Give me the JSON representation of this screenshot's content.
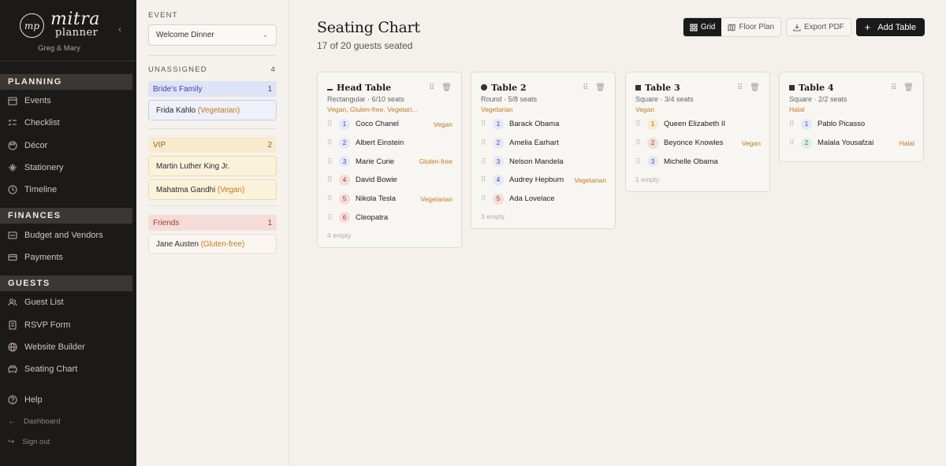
{
  "brand": {
    "logo_mark": "mp",
    "name_line1": "mitra",
    "name_line2": "planner",
    "couple": "Greg & Mary"
  },
  "nav": {
    "planning_header": "PLANNING",
    "planning": [
      "Events",
      "Checklist",
      "Décor",
      "Stationery",
      "Timeline"
    ],
    "finances_header": "FINANCES",
    "finances": [
      "Budget and Vendors",
      "Payments"
    ],
    "guests_header": "GUESTS",
    "guests": [
      "Guest List",
      "RSVP Form",
      "Website Builder",
      "Seating Chart"
    ],
    "help": "Help",
    "dashboard": "Dashboard",
    "signout": "Sign out"
  },
  "panel": {
    "event_label": "EVENT",
    "event_value": "Welcome Dinner",
    "unassigned_label": "UNASSIGNED",
    "unassigned_count": "4",
    "groups": [
      {
        "name": "Bride's Family",
        "count": "1",
        "guests": [
          {
            "name": "Frida Kahlo",
            "diet": "(Vegetarian)"
          }
        ]
      },
      {
        "name": "VIP",
        "count": "2",
        "guests": [
          {
            "name": "Martin Luther King Jr.",
            "diet": ""
          },
          {
            "name": "Mahatma Gandhi",
            "diet": "(Vegan)"
          }
        ]
      },
      {
        "name": "Friends",
        "count": "1",
        "guests": [
          {
            "name": "Jane Austen",
            "diet": "(Gluten-free)"
          }
        ]
      }
    ]
  },
  "main": {
    "title": "Seating Chart",
    "subtitle": "17 of 20 guests seated",
    "view_grid": "Grid",
    "view_floor": "Floor Plan",
    "export": "Export PDF",
    "add_table": "Add Table"
  },
  "tables": [
    {
      "name": "Head Table",
      "meta": "Rectangular · 6/10 seats",
      "diets": "Vegan, Gluten-free, Vegetari...",
      "empty": "4 empty",
      "seats": [
        {
          "n": "1",
          "name": "Coco Chanel",
          "diet": "Vegan"
        },
        {
          "n": "2",
          "name": "Albert Einstein",
          "diet": ""
        },
        {
          "n": "3",
          "name": "Marie Curie",
          "diet": "Gluten-free"
        },
        {
          "n": "4",
          "name": "David Bowie",
          "diet": ""
        },
        {
          "n": "5",
          "name": "Nikola Tesla",
          "diet": "Vegetarian"
        },
        {
          "n": "6",
          "name": "Cleopatra",
          "diet": ""
        }
      ]
    },
    {
      "name": "Table 2",
      "meta": "Round · 5/8 seats",
      "diets": "Vegetarian",
      "empty": "3 empty",
      "seats": [
        {
          "n": "1",
          "name": "Barack Obama",
          "diet": ""
        },
        {
          "n": "2",
          "name": "Amelia Earhart",
          "diet": ""
        },
        {
          "n": "3",
          "name": "Nelson Mandela",
          "diet": ""
        },
        {
          "n": "4",
          "name": "Audrey Hepburn",
          "diet": "Vegetarian"
        },
        {
          "n": "5",
          "name": "Ada Lovelace",
          "diet": ""
        }
      ]
    },
    {
      "name": "Table 3",
      "meta": "Square · 3/4 seats",
      "diets": "Vegan",
      "empty": "1 empty",
      "seats": [
        {
          "n": "1",
          "name": "Queen Elizabeth II",
          "diet": ""
        },
        {
          "n": "2",
          "name": "Beyonce Knowles",
          "diet": "Vegan"
        },
        {
          "n": "3",
          "name": "Michelle Obama",
          "diet": ""
        }
      ]
    },
    {
      "name": "Table 4",
      "meta": "Square · 2/2 seats",
      "diets": "Halal",
      "empty": "",
      "seats": [
        {
          "n": "1",
          "name": "Pablo Picasso",
          "diet": ""
        },
        {
          "n": "2",
          "name": "Malala Yousafzai",
          "diet": "Halal"
        }
      ]
    }
  ]
}
